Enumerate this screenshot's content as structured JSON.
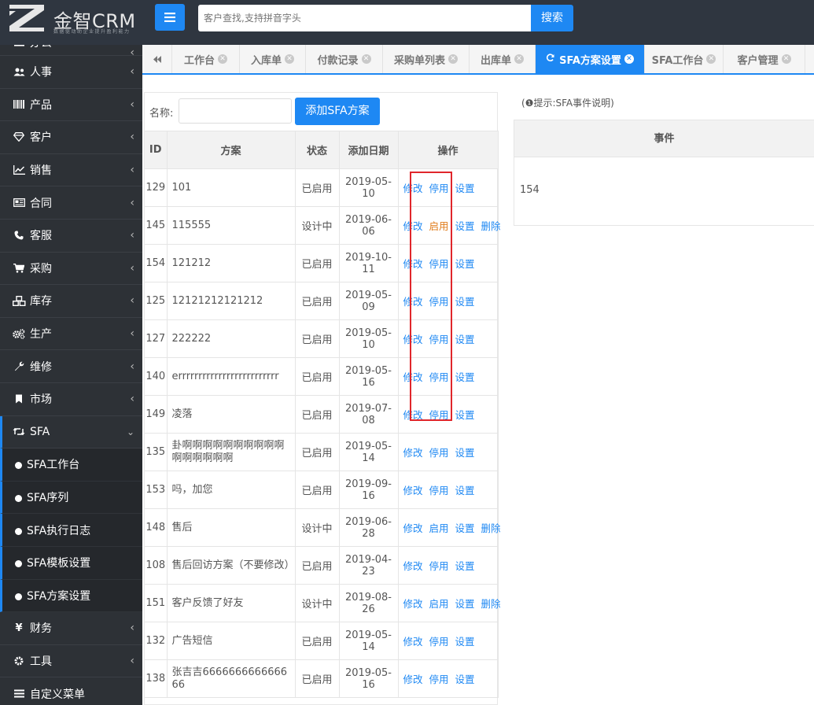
{
  "header": {
    "logo_text": "金智CRM",
    "logo_tagline": "数据驱动助企业提升盈利能力",
    "search_placeholder": "客户查找,支持拼音字头",
    "search_button": "搜索"
  },
  "sidebar": {
    "items": [
      {
        "label": "办公",
        "icon": "laptop-icon"
      },
      {
        "label": "人事",
        "icon": "users-icon"
      },
      {
        "label": "产品",
        "icon": "barcode-icon"
      },
      {
        "label": "客户",
        "icon": "diamond-icon"
      },
      {
        "label": "销售",
        "icon": "chart-line-icon"
      },
      {
        "label": "合同",
        "icon": "contract-icon"
      },
      {
        "label": "客服",
        "icon": "phone-icon"
      },
      {
        "label": "采购",
        "icon": "cart-icon"
      },
      {
        "label": "库存",
        "icon": "cubes-icon"
      },
      {
        "label": "生产",
        "icon": "gears-icon"
      },
      {
        "label": "维修",
        "icon": "wrench-icon"
      },
      {
        "label": "市场",
        "icon": "bookmark-icon"
      },
      {
        "label": "SFA",
        "icon": "retweet-icon"
      }
    ],
    "sfa_sub": [
      "SFA工作台",
      "SFA序列",
      "SFA执行日志",
      "SFA模板设置",
      "SFA方案设置"
    ],
    "bottom": [
      {
        "label": "财务",
        "icon": "yen-icon"
      },
      {
        "label": "工具",
        "icon": "cog-icon"
      },
      {
        "label": "自定义菜单",
        "icon": "list-icon"
      }
    ]
  },
  "tabs": [
    "工作台",
    "入库单",
    "付款记录",
    "采购单列表",
    "出库单",
    "SFA方案设置",
    "SFA工作台",
    "客户管理"
  ],
  "filter": {
    "name_label": "名称:",
    "add_button": "添加SFA方案"
  },
  "table": {
    "headers": {
      "id": "ID",
      "name": "方案",
      "status": "状态",
      "date": "添加日期",
      "ops": "操作"
    },
    "op_labels": {
      "edit": "修改",
      "stop": "停用",
      "start": "启用",
      "settings": "设置",
      "delete": "删除"
    },
    "rows": [
      {
        "id": "129",
        "name": "101",
        "status": "已启用",
        "date": "2019-05-10"
      },
      {
        "id": "145",
        "name": "115555",
        "status": "设计中",
        "date": "2019-06-06"
      },
      {
        "id": "154",
        "name": "121212",
        "status": "已启用",
        "date": "2019-10-11"
      },
      {
        "id": "125",
        "name": "12121212121212",
        "status": "已启用",
        "date": "2019-05-09"
      },
      {
        "id": "127",
        "name": "222222",
        "status": "已启用",
        "date": "2019-05-10"
      },
      {
        "id": "140",
        "name": "errrrrrrrrrrrrrrrrrrrrrrrr",
        "status": "已启用",
        "date": "2019-05-16"
      },
      {
        "id": "149",
        "name": "凌落",
        "status": "已启用",
        "date": "2019-07-08"
      },
      {
        "id": "135",
        "name": "卦啊啊啊啊啊啊啊啊啊啊啊啊啊啊啊啊",
        "status": "已启用",
        "date": "2019-05-14"
      },
      {
        "id": "153",
        "name": "吗，加您",
        "status": "已启用",
        "date": "2019-09-16"
      },
      {
        "id": "148",
        "name": "售后",
        "status": "设计中",
        "date": "2019-06-28"
      },
      {
        "id": "108",
        "name": "售后回访方案（不要修改）",
        "status": "已启用",
        "date": "2019-04-23"
      },
      {
        "id": "151",
        "name": "客户反馈了好友",
        "status": "设计中",
        "date": "2019-08-26"
      },
      {
        "id": "132",
        "name": "广告短信",
        "status": "已启用",
        "date": "2019-05-14"
      },
      {
        "id": "138",
        "name": "张吉吉666666666666666",
        "status": "已启用",
        "date": "2019-05-16"
      }
    ]
  },
  "right": {
    "hint": "(❶提示:SFA事件说明)",
    "event_header": "事件",
    "event_value": "154"
  },
  "colors": {
    "accent": "#1e88f3",
    "enabled_status": "#2f8a2f",
    "start_link": "#e07b1a",
    "highlight_box": "#e0262b",
    "topbar": "#2f3640",
    "sidebar": "#2d3136"
  }
}
